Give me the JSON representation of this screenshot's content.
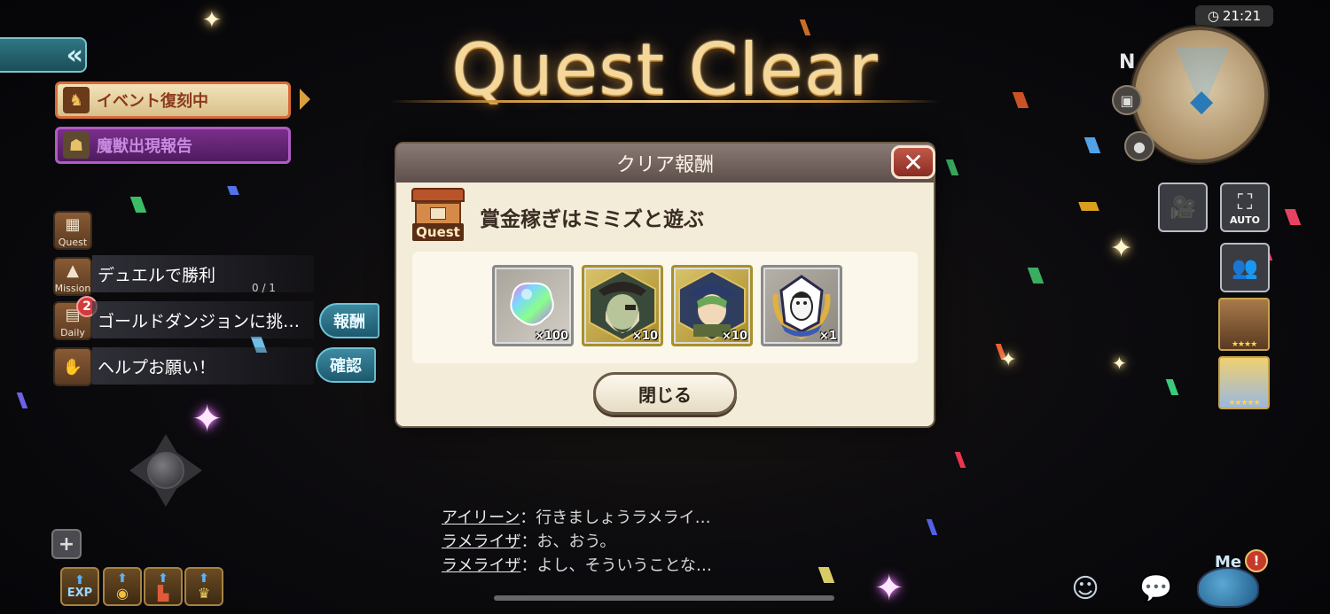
{
  "hud": {
    "collapse_label": "«",
    "banner_event": "イベント復刻中",
    "banner_beast": "魔獣出現報告",
    "quest_tab_label": "Quest",
    "missions": [
      {
        "tag": "Mission",
        "text": "デュエルで勝利",
        "progress": "0 / 1"
      },
      {
        "tag": "Daily",
        "text": "ゴールドダンジョンに挑…",
        "badge": "2",
        "button": "報酬"
      },
      {
        "tag": "",
        "text": "ヘルプお願い！",
        "button": "確認"
      }
    ],
    "plus_label": "+",
    "bottom_buttons": [
      "EXP",
      "",
      "",
      ""
    ],
    "clock": "21:21",
    "compass": "N",
    "auto_label": "AUTO",
    "me_label": "Me",
    "me_badge": "!",
    "portrait_1_stars": "★★★★",
    "portrait_2_stars": "★★★★★"
  },
  "title": "Quest Clear",
  "dialog": {
    "header": "クリア報酬",
    "quest_label": "Quest",
    "quest_name": "賞金稼ぎはミミズと遊ぶ",
    "rewards": [
      {
        "name": "rainbow-gem",
        "qty": "×100"
      },
      {
        "name": "pirate-card",
        "qty": "×10"
      },
      {
        "name": "green-hair-card",
        "qty": "×10"
      },
      {
        "name": "penguin-badge",
        "qty": "×1"
      }
    ],
    "close_button": "閉じる"
  },
  "chat": [
    {
      "speaker": "アイリーン",
      "text": "：行きましょうラメライ…"
    },
    {
      "speaker": "ラメライザ",
      "text": "：お、おう。"
    },
    {
      "speaker": "ラメライザ",
      "text": "：よし、そういうことな…"
    }
  ],
  "colors": {
    "title_gold": "#f6d79a",
    "dialog_bg": "#f3ecd9",
    "header_bg": "#6f605c",
    "accent_teal": "#2f7784"
  }
}
